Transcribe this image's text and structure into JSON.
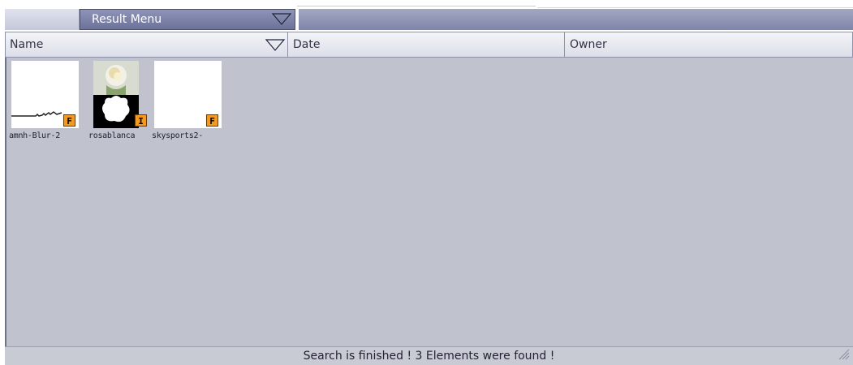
{
  "menu": {
    "result_menu_label": "Result Menu"
  },
  "columns": {
    "name": "Name",
    "date": "Date",
    "owner": "Owner"
  },
  "items": [
    {
      "name": "amnh-Blur-2",
      "badge": "F",
      "thumb": "image-thumbnail-mostly-white"
    },
    {
      "name": "rosablanca",
      "badge": "I",
      "thumb": "white-rose-with-black-white-mask"
    },
    {
      "name": "skysports2-",
      "badge": "F",
      "thumb": "image-thumbnail-white"
    }
  ],
  "status": {
    "text": "Search is finished ! 3 Elements were found !"
  },
  "colors": {
    "menu_bar": "#7d83a6",
    "results_background": "#c0c2ce",
    "badge": "#f39a1e"
  }
}
